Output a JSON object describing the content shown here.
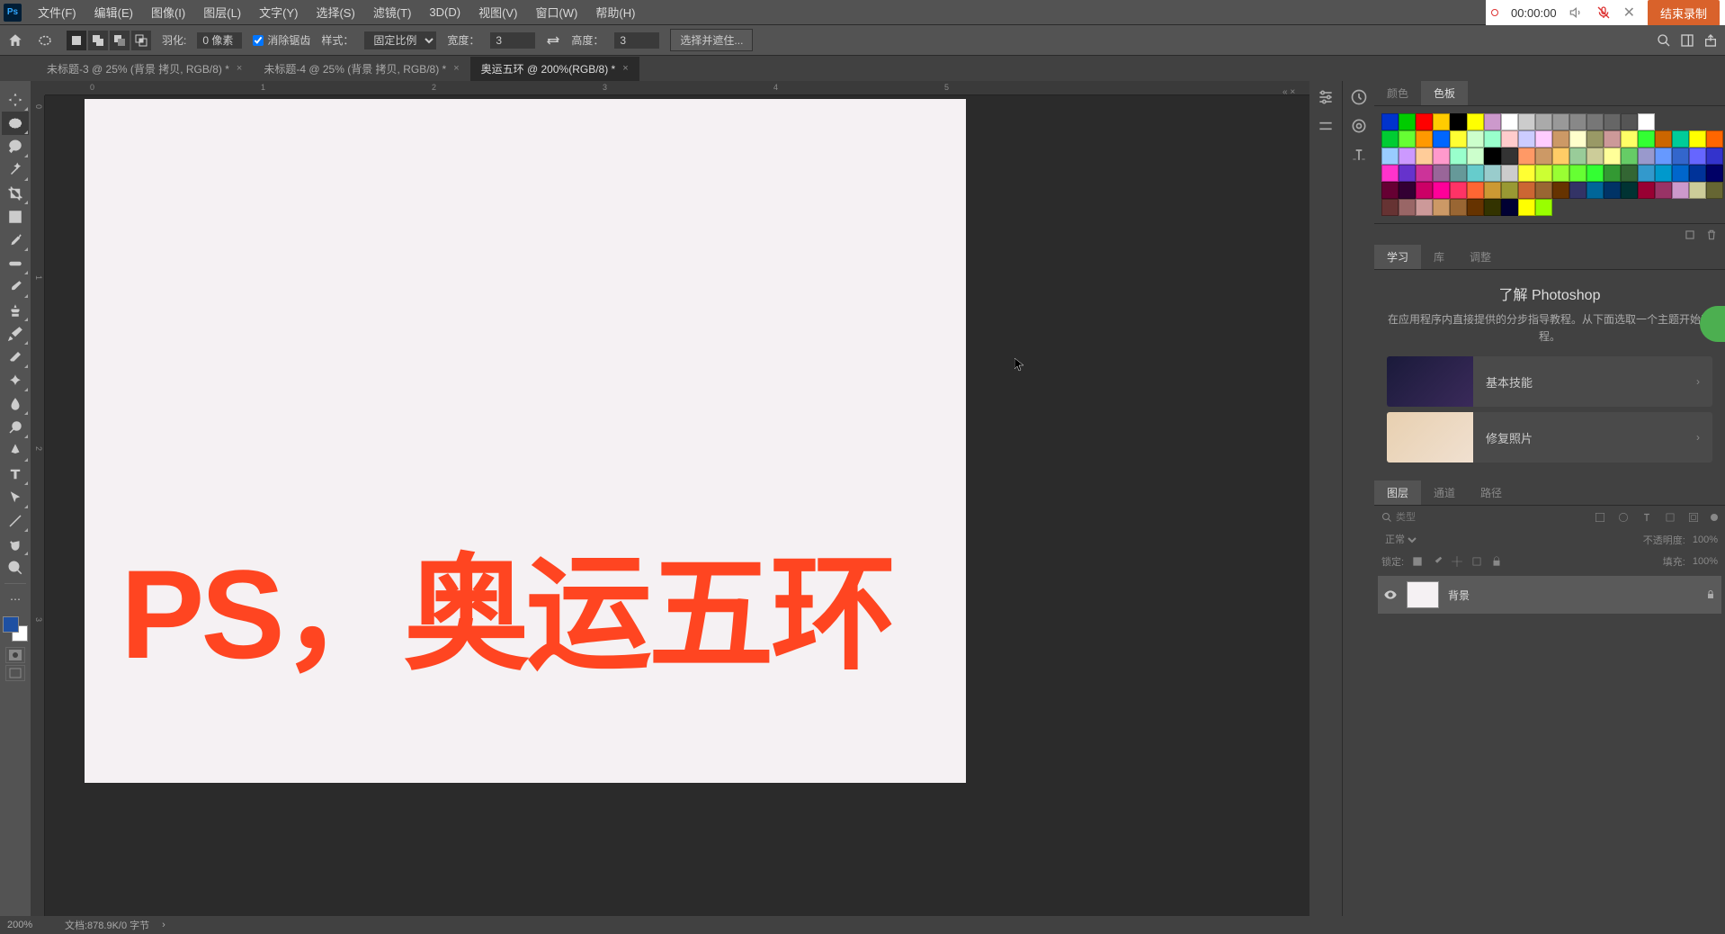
{
  "menu": {
    "file": "文件(F)",
    "edit": "编辑(E)",
    "image": "图像(I)",
    "layer": "图层(L)",
    "text": "文字(Y)",
    "select": "选择(S)",
    "filter": "滤镜(T)",
    "3d": "3D(D)",
    "view": "视图(V)",
    "window": "窗口(W)",
    "help": "帮助(H)"
  },
  "recorder": {
    "time": "00:00:00",
    "end": "结束录制"
  },
  "options": {
    "feather_lbl": "羽化:",
    "feather_val": "0 像素",
    "antialias": "消除锯齿",
    "style_lbl": "样式：",
    "style_val": "固定比例",
    "width_lbl": "宽度：",
    "width_val": "3",
    "height_lbl": "高度：",
    "height_val": "3",
    "mask_btn": "选择并遮住..."
  },
  "tabs": [
    {
      "label": "未标题-3 @ 25% (背景 拷贝, RGB/8) *",
      "active": false
    },
    {
      "label": "未标题-4 @ 25% (背景 拷贝, RGB/8) *",
      "active": false
    },
    {
      "label": "奥运五环 @ 200%(RGB/8) *",
      "active": true
    }
  ],
  "ruler_h": [
    "0",
    "1",
    "2",
    "3",
    "4",
    "5"
  ],
  "ruler_v": [
    "0",
    "1",
    "2",
    "3"
  ],
  "overlay": "PS，奥运五环",
  "color_tabs": {
    "color": "颜色",
    "swatches": "色板"
  },
  "swatch_rows": [
    [
      "#0033cc",
      "#00cc00",
      "#ff0000",
      "#ffcc00",
      "#000000",
      "#ffff00",
      "#cc99cc",
      "#ffffff",
      "#cccccc",
      "#aaaaaa",
      "#999999",
      "#888888",
      "#777777",
      "#666666",
      "#555555",
      "#ffffff"
    ],
    [
      "#00cc33",
      "#66ff33",
      "#ff9900",
      "#0066ff",
      "#ffff33",
      "#ccffcc",
      "#99ffcc",
      "#ffcccc",
      "#ccccff",
      "#ffccff",
      "#cc9966",
      "#ffffcc",
      "#999966",
      "#cc9999",
      "#ffff66",
      "#33ff33",
      "#cc6600",
      "#00cc99",
      "#ffff00",
      "#ff6600"
    ],
    [
      "#99ccff",
      "#cc99ff",
      "#ffcc99",
      "#ff99cc",
      "#99ffcc",
      "#ccffcc",
      "#000000",
      "#333333",
      "#ff9966",
      "#cc9966",
      "#ffcc66",
      "#99cc99",
      "#cccc99",
      "#ffff99",
      "#66cc66",
      "#9999cc",
      "#6699ff",
      "#3366cc",
      "#6666ff",
      "#3333cc"
    ],
    [
      "#ff33cc",
      "#6633cc",
      "#cc3399",
      "#996699",
      "#669999",
      "#66cccc",
      "#99cccc",
      "#cccccc",
      "#ffff33",
      "#ccff33",
      "#99ff33",
      "#66ff33",
      "#33ff33",
      "#339933",
      "#336633",
      "#3399cc",
      "#0099cc",
      "#0066cc",
      "#003399",
      "#000066"
    ],
    [
      "#660033",
      "#330033",
      "#cc0066",
      "#ff0099",
      "#ff3366",
      "#ff6633",
      "#cc9933",
      "#999933",
      "#cc6633",
      "#996633",
      "#663300",
      "#333366",
      "#006699",
      "#003366",
      "#003333",
      "#990033",
      "#993366",
      "#cc99cc",
      "#cccc99",
      "#666633"
    ],
    [
      "#663333",
      "#996666",
      "#cc9999",
      "#cc9966",
      "#996633",
      "#663300",
      "#333300",
      "#000033",
      "#ffff00",
      "#99ff00"
    ]
  ],
  "learn_tabs": {
    "learn": "学习",
    "lib": "库",
    "adjust": "调整"
  },
  "learn": {
    "title": "了解 Photoshop",
    "desc": "在应用程序内直接提供的分步指导教程。从下面选取一个主题开始教程。",
    "item1": "基本技能",
    "item2": "修复照片"
  },
  "layers_tabs": {
    "layers": "图层",
    "channels": "通道",
    "paths": "路径"
  },
  "layers": {
    "search_ph": "类型",
    "blend": "正常",
    "opacity_lbl": "不透明度:",
    "opacity_val": "100%",
    "lock_lbl": "锁定:",
    "fill_lbl": "填充:",
    "fill_val": "100%",
    "bg_layer": "背景"
  },
  "status": {
    "zoom": "200%",
    "doc": "文档:878.9K/0 字节"
  }
}
